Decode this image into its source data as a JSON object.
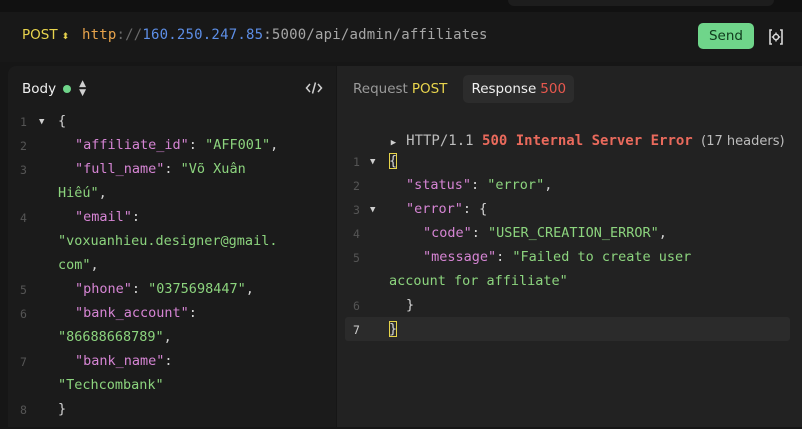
{
  "request": {
    "method": "POST",
    "url": {
      "protocol": "http",
      "separator": "://",
      "host": "160.250.247.85",
      "port": ":5000",
      "path": "/api/admin/affiliates"
    },
    "send_label": "Send"
  },
  "body_panel": {
    "title": "Body",
    "line_numbers": [
      "1",
      "2",
      "3",
      "",
      "4",
      "",
      "",
      "5",
      "6",
      "",
      "7",
      "",
      "8"
    ],
    "lines": [
      "{",
      "\"affiliate_id\": \"AFF001\",",
      "\"full_name\": \"Võ Xuân",
      "Hiếu\",",
      "\"email\":",
      "\"voxuanhieu.designer@gmail.",
      "com\",",
      "\"phone\": \"0375698447\",",
      "\"bank_account\":",
      "\"86688668789\",",
      "\"bank_name\":",
      "\"Techcombank\"",
      "}"
    ]
  },
  "response_panel": {
    "tab_request_label": "Request",
    "tab_request_method": "POST",
    "tab_response_label": "Response",
    "tab_response_code": "500",
    "http_version": "HTTP/1.1",
    "status_text": "500 Internal Server Error",
    "headers_count": "(17 headers)",
    "line_numbers": [
      "1",
      "2",
      "3",
      "4",
      "5",
      "",
      "6",
      "7"
    ],
    "lines": [
      "{",
      "\"status\": \"error\",",
      "\"error\": {",
      "\"code\": \"USER_CREATION_ERROR\",",
      "\"message\": \"Failed to create user",
      "account for affiliate\"",
      "}",
      "}"
    ]
  },
  "colors": {
    "method": "#e8d44d",
    "send_button": "#6fd58a",
    "error": "#ea6a5c",
    "json_key": "#d685d4",
    "json_string": "#8cd47e"
  },
  "icons": {
    "method_dropdown": "chevron-updown-icon",
    "settings": "bracket-settings-icon",
    "code_toggle": "code-icon",
    "collapse": "caret-down-icon"
  }
}
